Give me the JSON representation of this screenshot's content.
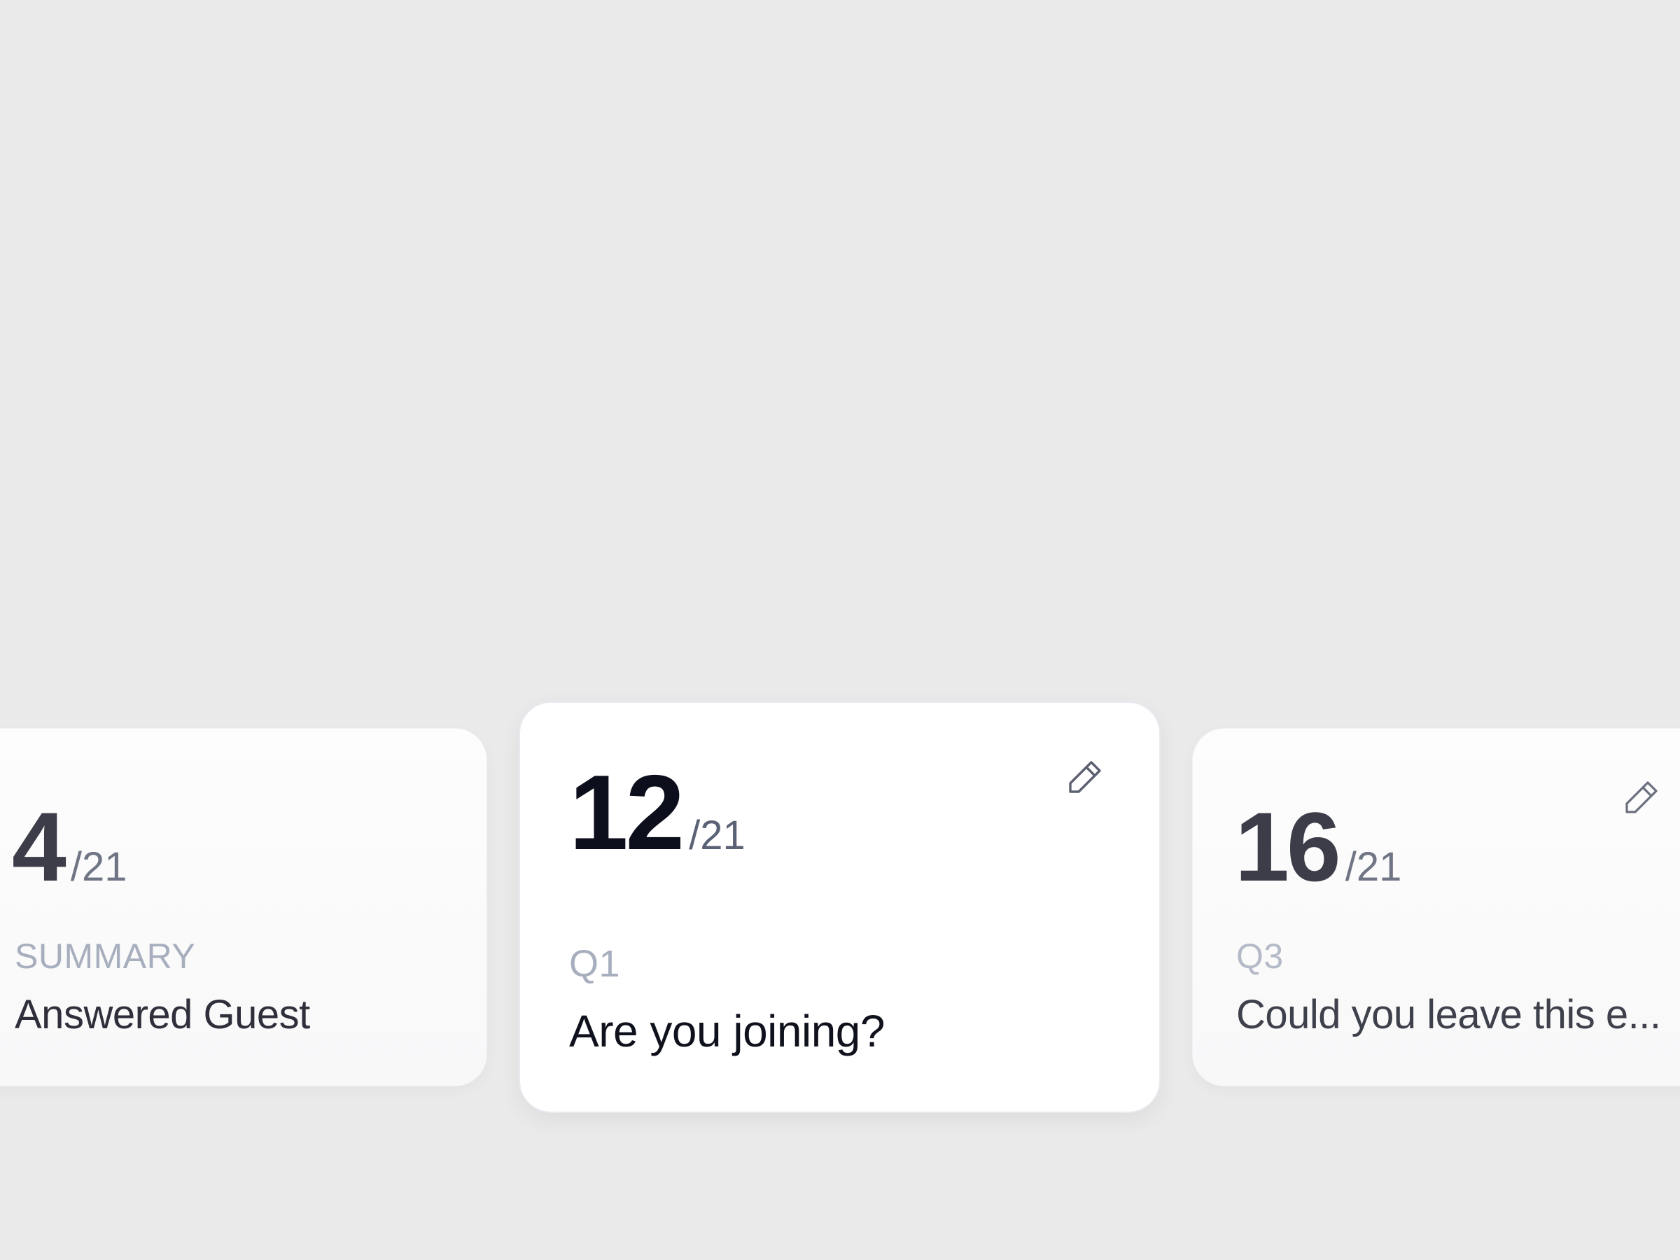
{
  "cards": [
    {
      "count": "4",
      "total": "/21",
      "label": "SUMMARY",
      "text": "Answered Guest",
      "edit_icon": null
    },
    {
      "count": "12",
      "total": "/21",
      "label": "Q1",
      "text": "Are you joining?",
      "edit_icon": "pencil-icon"
    },
    {
      "count": "16",
      "total": "/21",
      "label": "Q3",
      "text": "Could you leave this e...",
      "edit_icon": "pencil-icon"
    }
  ],
  "colors": {
    "background": "#eaeaeb",
    "card": "#ffffff",
    "label": "#a7aebd",
    "number": "#0c0e1c"
  }
}
